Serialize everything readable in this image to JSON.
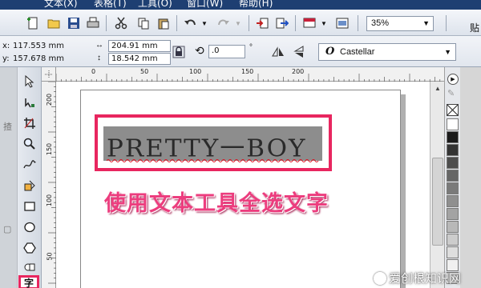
{
  "menubar": {
    "items": [
      "文本(X)",
      "表格(T)",
      "工具(O)",
      "窗口(W)",
      "帮助(H)"
    ]
  },
  "toolbar": {
    "zoom_value": "35%",
    "paste_label": "贴"
  },
  "propbar": {
    "x_label": "x:",
    "y_label": "y:",
    "x_value": "117.553 mm",
    "y_value": "157.678 mm",
    "width_value": "204.91 mm",
    "height_value": "18.542 mm",
    "rotation_value": ".0",
    "rotation_unit": "°",
    "font_name": "Castellar",
    "font_icon": "O"
  },
  "rulers": {
    "h_labels": [
      "0",
      "50",
      "100",
      "150",
      "200"
    ],
    "v_labels": [
      "200",
      "150",
      "100",
      "50"
    ]
  },
  "document": {
    "selected_text": "PRETTY一BOY",
    "annotation": "使用文本工具全选文字"
  },
  "palette": {
    "colors": [
      "#ffffff",
      "#1a1a1a",
      "#333333",
      "#4d4d4d",
      "#666666",
      "#7a7a7a",
      "#8f8f8f",
      "#a3a3a3",
      "#b8b8b8",
      "#cccccc",
      "#dedede",
      "#f0f0f0",
      "#c9c9c9"
    ]
  },
  "watermark": {
    "text": "爱创根知识网"
  },
  "colors": {
    "accent": "#e8265f",
    "annotation": "#ec3d7e",
    "menubar": "#1e3f72"
  }
}
